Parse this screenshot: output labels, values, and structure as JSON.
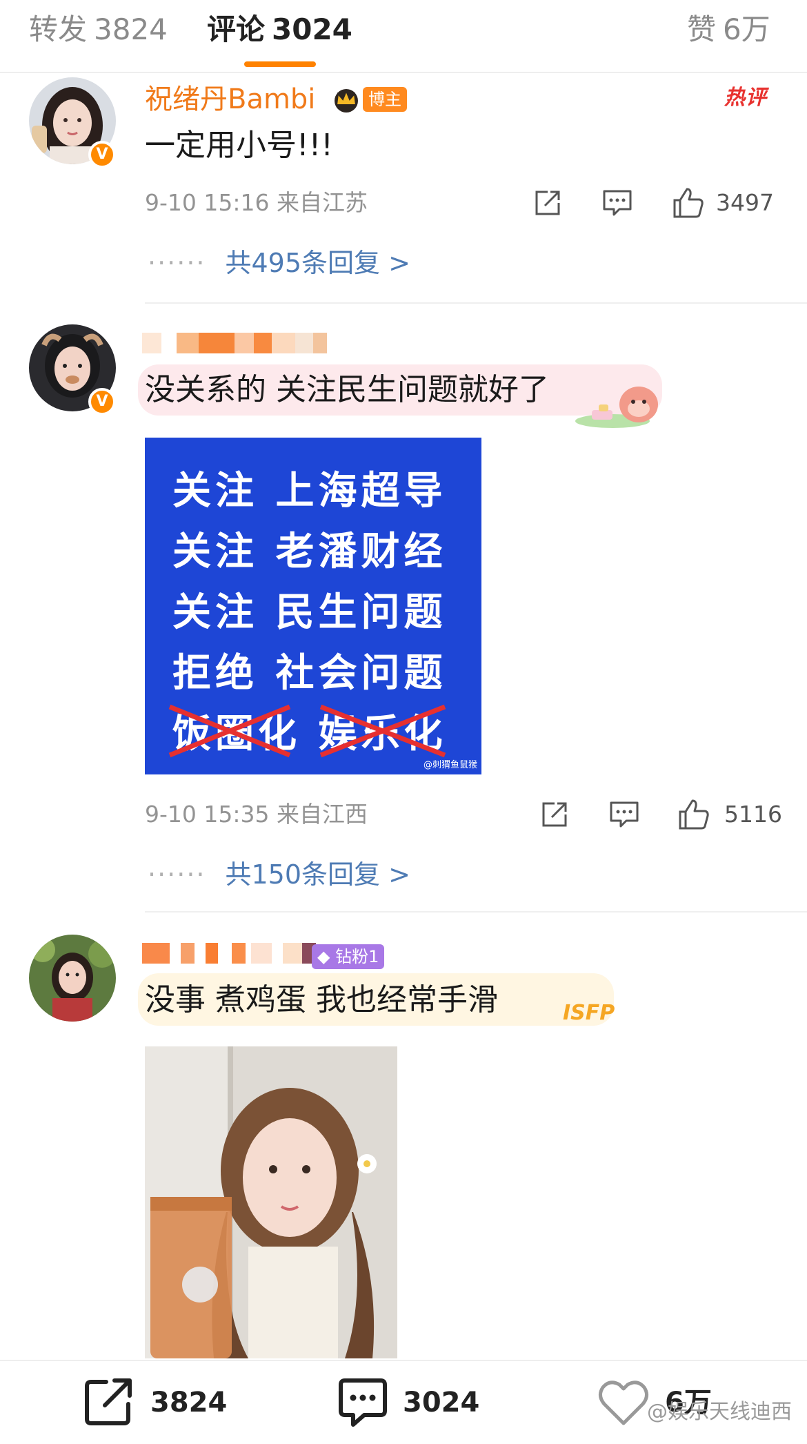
{
  "tabs": [
    {
      "label": "转发",
      "count": "3824"
    },
    {
      "label": "评论",
      "count": "3024"
    },
    {
      "label": "赞",
      "count": "6万"
    }
  ],
  "comments": [
    {
      "username": "祝绪丹Bambi",
      "role_tag": "博主",
      "hot_tag": "热评",
      "text": "一定用小号!!!",
      "time": "9-10 15:16",
      "location": "来自江苏",
      "likes": "3497",
      "replies": "共495条回复 >"
    },
    {
      "text": "没关系的 关注民生问题就好了",
      "image_lines": [
        "关注 上海超导",
        "关注 老潘财经",
        "关注 民生问题",
        "拒绝 社会问题",
        "饭圈化 娱乐化"
      ],
      "image_watermark": "@刺猬鱼鼠猴",
      "time": "9-10 15:35",
      "location": "来自江西",
      "likes": "5116",
      "replies": "共150条回复 >"
    },
    {
      "fan_badge": "钻粉1",
      "text": "没事 煮鸡蛋 我也经常手滑",
      "bubble_tag": "ISFP"
    }
  ],
  "bottom_bar": {
    "share_count": "3824",
    "comment_count": "3024",
    "like_count": "6万",
    "watermark": "@娱乐天线迪西"
  },
  "colors": {
    "accent": "#ff8200",
    "username": "#f07a1a",
    "link": "#4e7bb4",
    "poster_bg": "#1e46d6",
    "hot": "#e8322f"
  },
  "icons": [
    "share-icon",
    "comment-icon",
    "like-icon",
    "crown-icon",
    "verified-icon"
  ]
}
